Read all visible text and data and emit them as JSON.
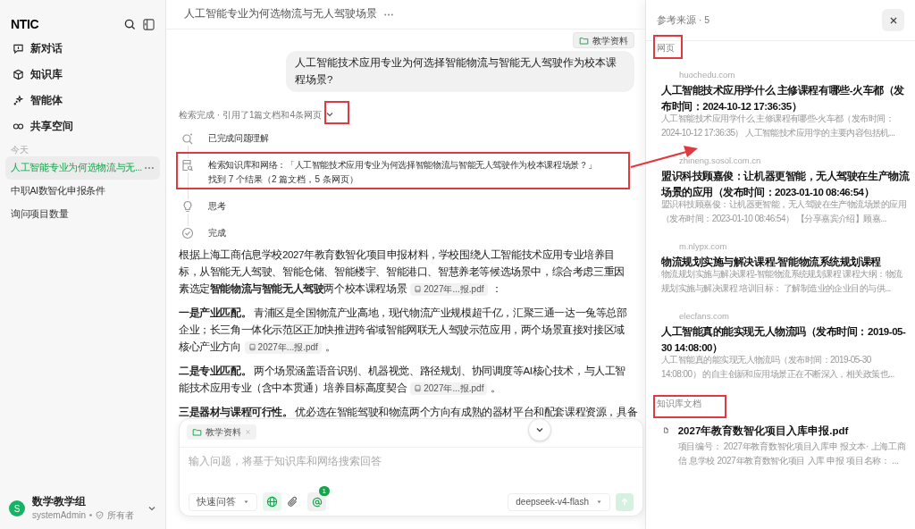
{
  "sidebar": {
    "logo": "NTIC",
    "nav": [
      {
        "kind": "new",
        "label": "新对话"
      },
      {
        "kind": "kb",
        "label": "知识库"
      },
      {
        "kind": "agent",
        "label": "智能体"
      },
      {
        "kind": "share",
        "label": "共享空间"
      }
    ],
    "history_group": "今天",
    "history": [
      {
        "label": "人工智能专业为何选物流与无...",
        "selected": true
      },
      {
        "label": "中职AI数智化申报条件",
        "selected": false
      },
      {
        "label": "询问项目数量",
        "selected": false
      }
    ],
    "user": {
      "avatar": "S",
      "name": "数学教学组",
      "account": "systemAdmin",
      "role": "所有者"
    }
  },
  "chat": {
    "title": "人工智能专业为何选物流与无人驾驶场景",
    "tag": "教学资料",
    "question": "人工智能技术应用专业为何选择智能物流与智能无人驾驶作为校本课程场景?",
    "status": "检索完成 · 引用了1篇文档和4条网页",
    "expanded": true,
    "steps": [
      {
        "kind": "understand",
        "label": "已完成问题理解"
      },
      {
        "kind": "search",
        "label": "检索知识库和网络：「人工智能技术应用专业为何选择智能物流与智能无人驾驶作为校本课程场景？」",
        "detail": "找到 7 个结果（2 篇文档，5 条网页）"
      },
      {
        "kind": "think",
        "label": "思考"
      },
      {
        "kind": "done",
        "label": "完成"
      }
    ],
    "answer": [
      {
        "text": "根据上海工商信息学校2027年教育数智化项目申报材料，学校围绕人工智能技术应用专业培养目标，从智能无人驾驶、智能仓储、智能楼宇、智能港口、智慧养老等候选场景中，综合考虑三重因素选定**智能物流与智能无人驾驶**两个校本课程场景",
        "citation": "2027年...报.pdf",
        "tail": "："
      },
      {
        "text": "**一是产业匹配。** 青浦区是全国物流产业高地，现代物流产业规模超千亿，汇聚三通一达一兔等总部企业；长三角一体化示范区正加快推进跨省域智能网联无人驾驶示范应用，两个场景直接对接区域核心产业方向",
        "citation": "2027年...报.pdf",
        "tail": "。"
      },
      {
        "text": "**二是专业匹配。** 两个场景涵盖语音识别、机器视觉、路径规划、协同调度等AI核心技术，与人工智能技术应用专业（含中本贯通）培养目标高度契合",
        "citation": "2027年...报.pdf",
        "tail": "。"
      },
      {
        "text": "**三是器材与课程可行性。** 优必选在智能驾驶和物流两个方向有成熟的器材平台和配套课程资源，具备"
      }
    ],
    "composer": {
      "tag": "教学资料",
      "placeholder": "输入问题，将基于知识库和网络搜索回答",
      "mode": "快速问答",
      "web_search": {
        "on": true
      },
      "mention_count": "1",
      "model": "deepseek-v4-flash",
      "send": {
        "disabled": true
      }
    }
  },
  "sources": {
    "title": "参考来源 · 5",
    "web_heading": "网页",
    "web": [
      {
        "domain": "huochedu.com",
        "title": "人工智能技术应用学什么 主修课程有哪些-火车都（发布时间：2024-10-12 17:36:35）",
        "snippet": "人工智能技术应用学什么 主修课程有哪些-火车都（发布时间：2024-10-12 17:36:35） 人工智能技术应用学的主要内容包括机..."
      },
      {
        "domain": "zhineng.sosol.com.cn",
        "title": "盟识科技顾嘉俊：让机器更智能，无人驾驶在生产物流场景的应用（发布时间：2023-01-10 08:46:54）",
        "snippet": "盟识科技顾嘉俊：让机器更智能，无人驾驶在生产物流场景的应用（发布时间：2023-01-10 08:46:54） 【分享嘉宾介绍】顾嘉..."
      },
      {
        "domain": "m.nlypx.com",
        "title": "物流规划实施与解决课程-智能物流系统规划课程",
        "snippet": "物流规划实施与解决课程-智能物流系统规划课程 课程大纲：物流规划实施与解决课程 培训目标： 了解制造业的企业目的与供..."
      },
      {
        "domain": "elecfans.com",
        "title": "人工智能真的能实现无人物流吗（发布时间：2019-05-30 14:08:00）",
        "snippet": "人工智能真的能实现无人物流吗（发布时间：2019-05-30 14:08:00） 的自主创新和应用场景正在不断深入，相关政策也..."
      }
    ],
    "kb_heading": "知识库文档",
    "docs": [
      {
        "title": "2027年教育数智化项目入库申报.pdf",
        "snippet": "项目编号： 2027年教育数智化项目入库申 报文本· 上海工商信 息学校 2027年教育数智化项目 入库 申报 项目名称： ..."
      }
    ]
  }
}
